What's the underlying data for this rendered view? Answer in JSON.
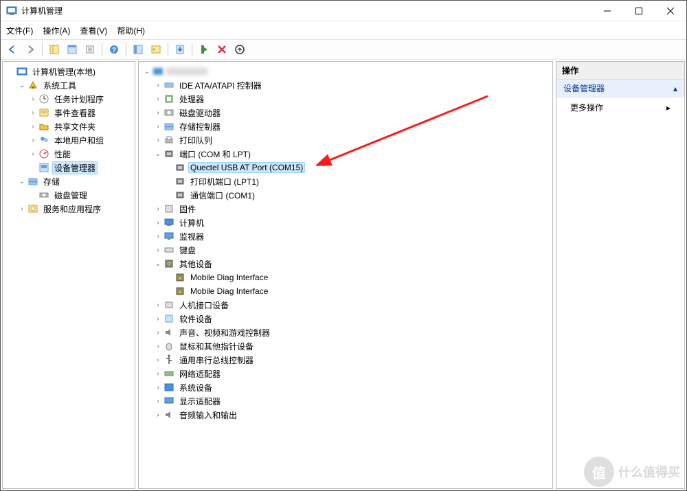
{
  "window": {
    "title": "计算机管理"
  },
  "menu": {
    "file": "文件(F)",
    "action": "操作(A)",
    "view": "查看(V)",
    "help": "帮助(H)"
  },
  "left_tree": {
    "root": "计算机管理(本地)",
    "system_tools": "系统工具",
    "task_scheduler": "任务计划程序",
    "event_viewer": "事件查看器",
    "shared_folders": "共享文件夹",
    "local_users": "本地用户和组",
    "performance": "性能",
    "device_manager": "设备管理器",
    "storage": "存储",
    "disk_management": "磁盘管理",
    "services_apps": "服务和应用程序"
  },
  "center_tree": {
    "root_blurred": " ",
    "ide": "IDE ATA/ATAPI 控制器",
    "cpu": "处理器",
    "disk_drives": "磁盘驱动器",
    "storage_ctrl": "存储控制器",
    "print_queues": "打印队列",
    "ports": "端口 (COM 和 LPT)",
    "port_quectel": "Quectel USB AT Port (COM15)",
    "port_printer": "打印机端口 (LPT1)",
    "port_comm": "通信端口 (COM1)",
    "firmware": "固件",
    "computer": "计算机",
    "monitors": "监视器",
    "keyboards": "键盘",
    "other_devices": "其他设备",
    "mobile_diag1": "Mobile Diag Interface",
    "mobile_diag2": "Mobile Diag Interface",
    "hid": "人机接口设备",
    "software_devices": "软件设备",
    "sound": "声音、视频和游戏控制器",
    "mice": "鼠标和其他指针设备",
    "usb": "通用串行总线控制器",
    "network": "网络适配器",
    "system_devices": "系统设备",
    "display": "显示适配器",
    "audio_io": "音频输入和输出"
  },
  "right_panel": {
    "header": "操作",
    "section": "设备管理器",
    "more_actions": "更多操作"
  },
  "watermark": {
    "text": "什么值得买",
    "badge": "值"
  }
}
